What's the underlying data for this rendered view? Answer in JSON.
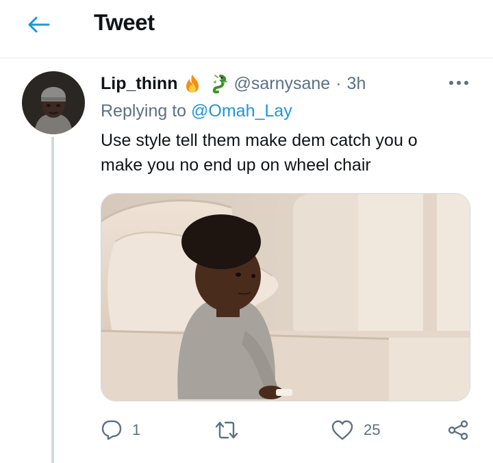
{
  "header": {
    "title": "Tweet"
  },
  "tweet": {
    "author_name": "Lip_thinn",
    "author_emojis": [
      "fire-emoji",
      "dragon-emoji"
    ],
    "handle": "@sarnysane",
    "separator": "·",
    "time": "3h",
    "replying_prefix": "Replying to ",
    "replying_to": "@Omah_Lay",
    "text_line1": "Use style tell them make dem catch you o",
    "text_line2": "make you no end up on wheel chair",
    "media": "photo-toddler-on-beige-sofa",
    "actions": {
      "reply_count": "1",
      "retweet_count": "",
      "like_count": "25"
    }
  },
  "colors": {
    "accent": "#1b95e0",
    "muted_text": "#5b7083",
    "thread_line": "#cfd9de",
    "divider": "#e6ecf0"
  },
  "icons": [
    "back-arrow-icon",
    "more-icon",
    "reply-icon",
    "retweet-icon",
    "like-icon",
    "share-icon"
  ]
}
